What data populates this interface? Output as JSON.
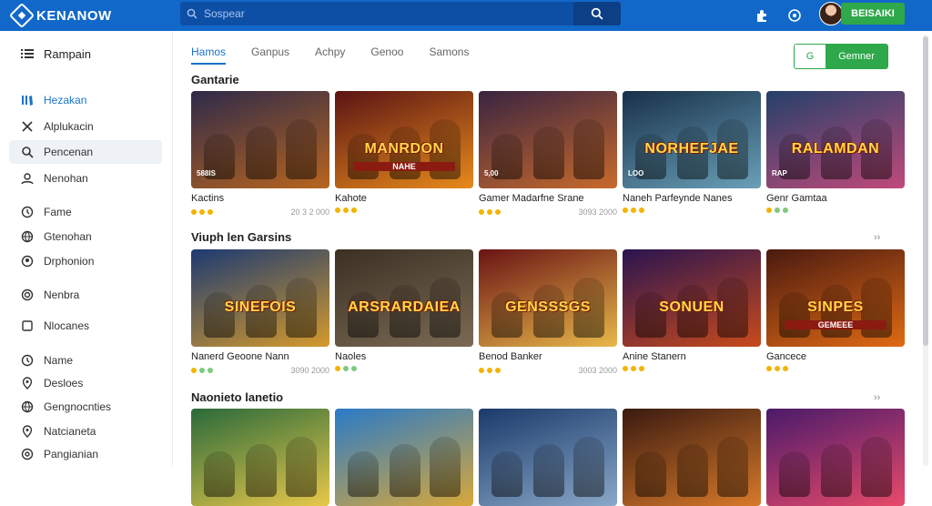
{
  "header": {
    "brand": "KENANOW",
    "search_placeholder": "Sospear",
    "user_label": "BEISAIKI"
  },
  "sidebar": {
    "title": "Rampain",
    "items": [
      {
        "label": "Hezakan",
        "icon": "library-icon"
      },
      {
        "label": "Alplukacin",
        "icon": "cross-icon"
      },
      {
        "label": "Pencenan",
        "icon": "search-icon"
      },
      {
        "label": "Nenohan",
        "icon": "person-icon"
      },
      {
        "label": "Fame",
        "icon": "clock-icon"
      },
      {
        "label": "Gtenohan",
        "icon": "globe-icon"
      },
      {
        "label": "Drphonion",
        "icon": "user-icon"
      },
      {
        "label": "Nenbra",
        "icon": "target-icon"
      },
      {
        "label": "Nlocanes",
        "icon": "square-icon"
      },
      {
        "label": "Name",
        "icon": "clock-icon"
      },
      {
        "label": "Desloes",
        "icon": "location-icon"
      },
      {
        "label": "Gengnocnties",
        "icon": "globe-icon"
      },
      {
        "label": "Natcianeta",
        "icon": "location-icon"
      },
      {
        "label": "Pangianian",
        "icon": "at-icon"
      }
    ]
  },
  "tabs": [
    "Hamos",
    "Ganpus",
    "Achpy",
    "Genoo",
    "Samons"
  ],
  "cta": {
    "left": "G",
    "right": "Gemner"
  },
  "sections": [
    {
      "title": "Gantarie",
      "more": "",
      "cards": [
        {
          "name": "Kactins",
          "meta": "20 3 2 000",
          "thumb_title": "",
          "corner": "588IS",
          "palette": [
            "#2e2a4a",
            "#b8651e"
          ],
          "dots": [
            "#f2b400",
            "#f2b400",
            "#f2b400"
          ]
        },
        {
          "name": "Kahote",
          "meta": "",
          "thumb_title": "MANRDON",
          "sub": "NAHE",
          "corner": "",
          "palette": [
            "#5a1414",
            "#e88a1c"
          ],
          "dots": [
            "#f2b400",
            "#f2b400",
            "#f2b400"
          ]
        },
        {
          "name": "Gamer Madarfne Srane",
          "meta": "3093 2000",
          "thumb_title": "",
          "corner": "5,00",
          "palette": [
            "#3a2440",
            "#c86a2c"
          ],
          "dots": [
            "#f2b400",
            "#f2b400",
            "#f2b400"
          ]
        },
        {
          "name": "Naneh Parfeynde Nanes",
          "meta": "",
          "thumb_title": "NORHEFJAE",
          "corner": "LOO",
          "palette": [
            "#18304a",
            "#6aa0b8"
          ],
          "dots": [
            "#f2b400",
            "#f2b400",
            "#f2b400"
          ]
        },
        {
          "name": "Genr Gamtaa",
          "meta": "",
          "thumb_title": "RALAMDAN",
          "corner": "RAP",
          "palette": [
            "#24406a",
            "#c04a7a"
          ],
          "dots": [
            "#f2b400",
            "#7fc97f",
            "#7fc97f"
          ]
        }
      ]
    },
    {
      "title": "Viuph len Garsins",
      "more": "››",
      "cards": [
        {
          "name": "Nanerd Geoone Nann",
          "meta": "3090 2000",
          "thumb_title": "SINEFOIS",
          "corner": "",
          "palette": [
            "#1c3a72",
            "#d49a2c"
          ],
          "dots": [
            "#f2b400",
            "#7fc97f",
            "#7fc97f"
          ]
        },
        {
          "name": "Naoles",
          "meta": "",
          "thumb_title": "ARSRARDAIEA",
          "corner": "",
          "palette": [
            "#3c3024",
            "#7a6a54"
          ],
          "dots": [
            "#f2b400",
            "#7fc97f",
            "#7fc97f"
          ]
        },
        {
          "name": "Benod Banker",
          "meta": "3003 2000",
          "thumb_title": "GENSSSGS",
          "corner": "",
          "palette": [
            "#6a1414",
            "#e8b84a"
          ],
          "dots": [
            "#f2b400",
            "#f2b400",
            "#f2b400"
          ]
        },
        {
          "name": "Anine Stanern",
          "meta": "",
          "thumb_title": "SONUEN",
          "corner": "",
          "palette": [
            "#2a1450",
            "#c84a1c"
          ],
          "dots": [
            "#f2b400",
            "#f2b400",
            "#f2b400"
          ]
        },
        {
          "name": "Gancece",
          "meta": "",
          "thumb_title": "SINPES",
          "sub": "GEMEEE",
          "corner": "",
          "palette": [
            "#4a1a10",
            "#e06a14"
          ],
          "dots": [
            "#f2b400",
            "#f2b400",
            "#f2b400"
          ]
        }
      ]
    },
    {
      "title": "Naonieto lanetio",
      "more": "››",
      "cards": [
        {
          "name": "",
          "meta": "",
          "thumb_title": "",
          "corner": "",
          "palette": [
            "#2a6a3a",
            "#e8c84a"
          ],
          "dots": []
        },
        {
          "name": "",
          "meta": "",
          "thumb_title": "",
          "corner": "",
          "palette": [
            "#2a7ac8",
            "#d8a83a"
          ],
          "dots": []
        },
        {
          "name": "",
          "meta": "",
          "thumb_title": "",
          "corner": "",
          "palette": [
            "#1a3a6a",
            "#8aa8c8"
          ],
          "dots": []
        },
        {
          "name": "",
          "meta": "",
          "thumb_title": "",
          "corner": "",
          "palette": [
            "#3a1a10",
            "#d87a2a"
          ],
          "dots": []
        },
        {
          "name": "",
          "meta": "",
          "thumb_title": "",
          "corner": "",
          "palette": [
            "#4a1a6a",
            "#e84a6a"
          ],
          "dots": []
        }
      ]
    }
  ]
}
